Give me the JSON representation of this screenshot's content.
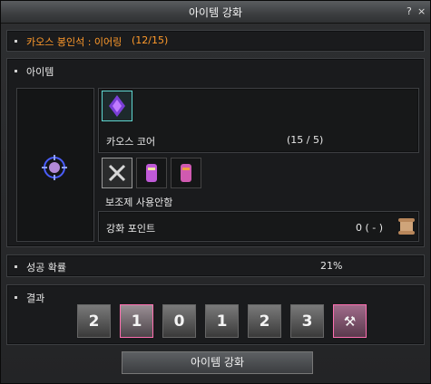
{
  "window": {
    "title": "아이템 강화",
    "help_label": "?",
    "close_label": "×"
  },
  "seal": {
    "label": "카오스 봉인석 : 이어링",
    "count": "(12/15)",
    "color": "#ff9a2b"
  },
  "item_section": {
    "label": "아이템"
  },
  "core": {
    "label": "카오스 코어",
    "count": "(15 / 5)"
  },
  "aux": {
    "label": "보조제 사용안함"
  },
  "points": {
    "label": "강화 포인트",
    "value": "0 ( - )"
  },
  "success": {
    "label": "성공 확률",
    "value": "21%"
  },
  "result": {
    "label": "결과",
    "tiles": [
      {
        "text": "2",
        "kind": "down2"
      },
      {
        "text": "1",
        "kind": "down1-selected"
      },
      {
        "text": "0",
        "kind": "zero"
      },
      {
        "text": "1",
        "kind": "up1"
      },
      {
        "text": "2",
        "kind": "up2"
      },
      {
        "text": "3",
        "kind": "up3"
      },
      {
        "text": "",
        "kind": "destroy"
      }
    ]
  },
  "enhance_button": {
    "label": "아이템 강화"
  }
}
